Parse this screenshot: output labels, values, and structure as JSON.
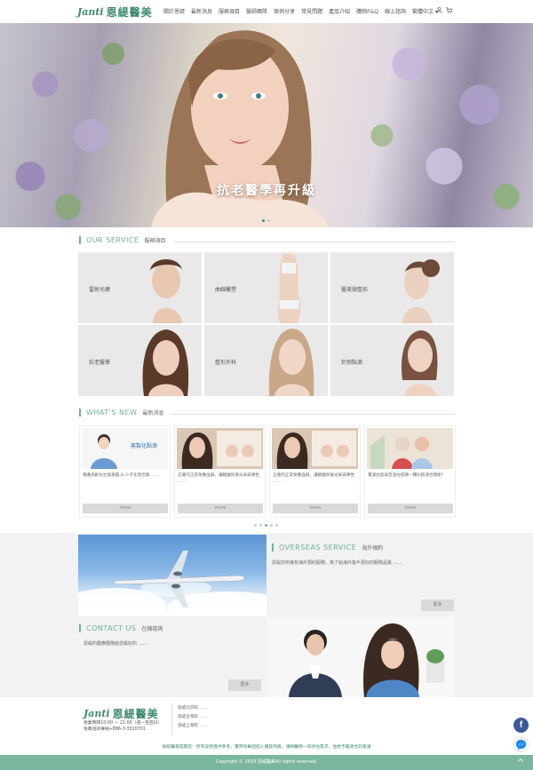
{
  "header": {
    "logo_mark": "Janti",
    "logo_text": "恩緹醫美",
    "nav": [
      "關於恩緹",
      "最新消息",
      "服務項目",
      "醫師團隊",
      "案例分享",
      "常見問題",
      "產品介紹",
      "購物F&Q",
      "線上諮詢",
      "繁體中文 ▾"
    ]
  },
  "hero": {
    "title": "抗老醫學再升級"
  },
  "services": {
    "en": "OUR SERVICE",
    "zh": "服務項目",
    "items": [
      {
        "label": "雷射光療"
      },
      {
        "label": "曲線雕塑"
      },
      {
        "label": "醫美微整形"
      },
      {
        "label": "抗老醫學"
      },
      {
        "label": "整形外科"
      },
      {
        "label": "針劑點滴"
      }
    ]
  },
  "news": {
    "en": "WHAT'S NEW",
    "zh": "最新消息",
    "more_label": "more",
    "items": [
      {
        "text": "隨著高齡化社會來臨 & 少子化等因素 ……",
        "thumb_caption": "客製化點滴"
      },
      {
        "text": "正確的正常保養強調，讓臉龐恢復光采與彈性 ……",
        "thumb_caption": ""
      },
      {
        "text": "正確的正常保養強調，讓臉龐恢復光采與彈性 ……",
        "thumb_caption": ""
      },
      {
        "text": "電波拉提與音波拉提哪一種比較適合我呢？",
        "thumb_caption": ""
      }
    ]
  },
  "overseas": {
    "en": "OVERSEAS SERVICE",
    "zh": "海外預約",
    "text": "恩緹診所擁有海外預約服務，為了給海外客戶更好的服務品質 ……",
    "more_label": "更多"
  },
  "contact": {
    "en": "CONTACT US",
    "zh": "在線諮詢",
    "text": "恩緹的醫療團隊給您最好的 ……",
    "more_label": "更多"
  },
  "footer": {
    "logo_mark": "Janti",
    "logo_text": "恩緹醫美",
    "hours": "營業時間10:00 ～ 21:00（週一至週日）",
    "phone": "免費諮詢專線+886-3-3320701",
    "addresses": [
      "恩緹北京院 ……",
      "恩緹台灣院 ……",
      "恩緹上海院 ……"
    ],
    "disclaimer": "恩緹醫美提醒您：所有案例僅供參考，實際效果因個人體質而異，請將醫師一同評估需求，並給予最適合的建議",
    "copyright": "Copyright © 2019 恩緹醫美All rights reserved."
  }
}
